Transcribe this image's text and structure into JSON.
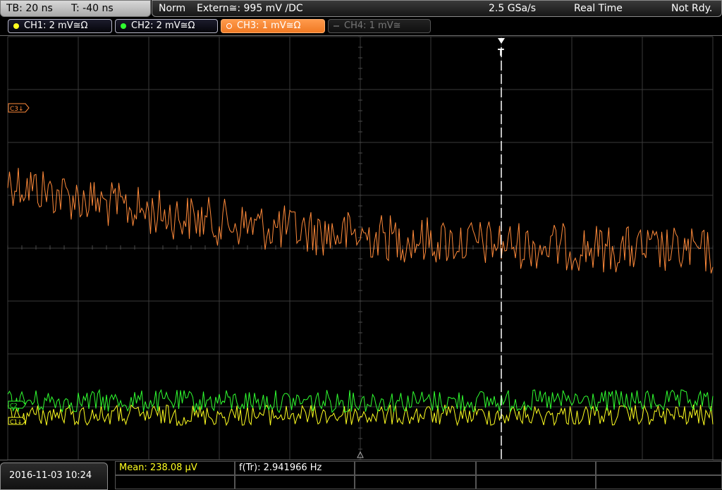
{
  "topbar": {
    "timebase": "TB: 20 ns",
    "trigger_offset": "T: -40 ns",
    "trigger_mode": "Norm",
    "trigger_source": "Extern≅: 995 mV ∕DC",
    "sample_rate": "2.5 GSa/s",
    "acq_mode": "Real Time",
    "status": "Not Rdy."
  },
  "channels": [
    {
      "label": "CH1: 2 mV≅Ω",
      "color": "#ffff20",
      "active": true
    },
    {
      "label": "CH2: 2 mV≅Ω",
      "color": "#30ff30",
      "active": true
    },
    {
      "label": "CH3: 1 mV≅Ω",
      "color": "#ff8a3a",
      "active": true,
      "selected": true
    },
    {
      "label": "CH4: 1 mV≅",
      "color": "#666666",
      "active": false
    }
  ],
  "markers": {
    "ch3": "C3↓",
    "ch2": "C2",
    "ch1": "C1↓",
    "trigger_t": "T"
  },
  "measurements": {
    "mean": "Mean: 238.08 µV",
    "freq": "f(Tr): 2.941966 Hz"
  },
  "datetime": "2016-11-03 10:24",
  "colors": {
    "ch1": "#ffff20",
    "ch2": "#30ff30",
    "ch3": "#ff8a3a",
    "grid": "#3a3a3a"
  }
}
